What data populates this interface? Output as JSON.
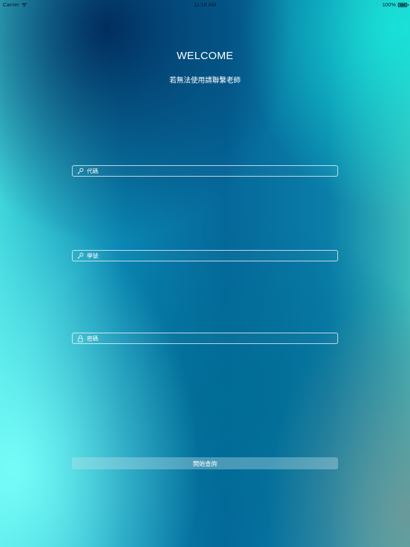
{
  "status_bar": {
    "carrier": "Carrier",
    "time": "11:16 AM",
    "battery": "100%"
  },
  "header": {
    "title": "WELCOME",
    "subtitle": "若無法使用請聯繫老師"
  },
  "form": {
    "code_field": {
      "placeholder": "代碼",
      "value": "",
      "icon": "key-icon"
    },
    "student_id_field": {
      "placeholder": "學號",
      "value": "",
      "icon": "key-icon"
    },
    "password_field": {
      "placeholder": "密碼",
      "value": "",
      "icon": "lock-icon"
    },
    "submit_label": "開始查詢"
  },
  "colors": {
    "text": "#ffffff",
    "field_border": "#ffffff",
    "status_text": "#0a1a2a"
  }
}
